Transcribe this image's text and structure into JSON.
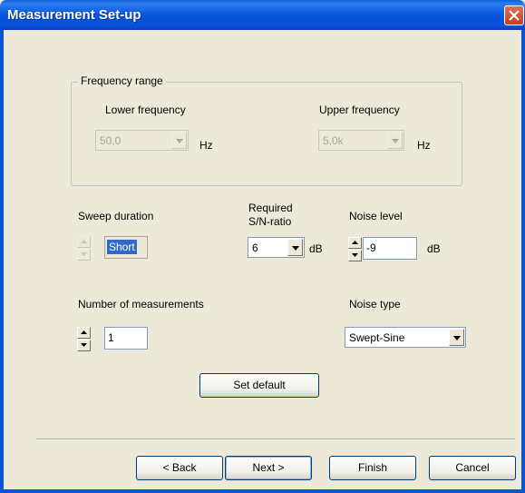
{
  "window": {
    "title": "Measurement Set-up"
  },
  "frequency_range": {
    "label": "Frequency range",
    "lower": {
      "label": "Lower frequency",
      "value": "50,0",
      "unit": "Hz"
    },
    "upper": {
      "label": "Upper frequency",
      "value": "5,0k",
      "unit": "Hz"
    }
  },
  "sweep": {
    "label": "Sweep duration",
    "value": "Short"
  },
  "sn_ratio": {
    "label_line1": "Required",
    "label_line2": "S/N-ratio",
    "value": "6",
    "unit": "dB"
  },
  "noise_level": {
    "label": "Noise level",
    "value": "-9",
    "unit": "dB"
  },
  "measurements": {
    "label": "Number of measurements",
    "value": "1"
  },
  "noise_type": {
    "label": "Noise type",
    "value": "Swept-Sine"
  },
  "buttons": {
    "set_default": "Set default",
    "back": "< Back",
    "next": "Next >",
    "finish": "Finish",
    "cancel": "Cancel"
  },
  "icons": {
    "close": "close-icon",
    "dropdown": "chevron-down-icon",
    "spin_up": "spin-up-icon",
    "spin_down": "spin-down-icon"
  }
}
